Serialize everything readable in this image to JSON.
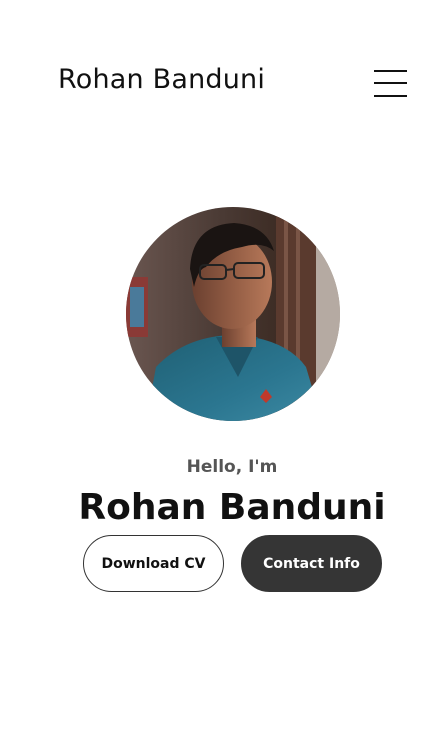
{
  "header": {
    "logo": "Rohan Banduni",
    "menu_icon": "hamburger-menu-icon"
  },
  "profile": {
    "photo_alt": "Profile picture",
    "greeting": "Hello, I'm",
    "name": "Rohan Banduni"
  },
  "actions": {
    "download_cv": "Download CV",
    "contact_info": "Contact Info"
  },
  "colors": {
    "text": "#111111",
    "greeting": "#555555",
    "primary_button_bg": "#353535",
    "background": "#ffffff"
  }
}
